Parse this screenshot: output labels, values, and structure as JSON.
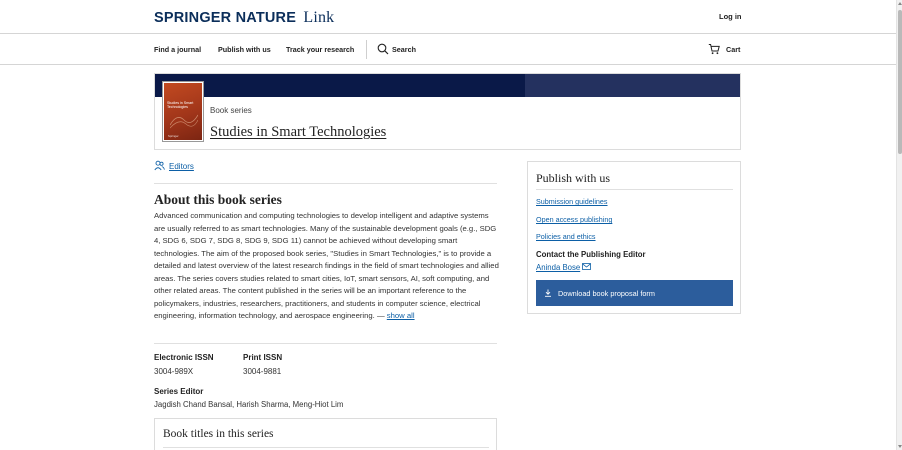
{
  "header": {
    "logo_brand": "SPRINGER NATURE",
    "logo_link": "Link",
    "login_label": "Log in"
  },
  "nav": {
    "find_journal": "Find a journal",
    "publish_with_us": "Publish with us",
    "track_research": "Track your research",
    "search_label": "Search",
    "cart_label": "Cart"
  },
  "hero": {
    "cover_title": "Studies in Smart Technologies",
    "cover_publisher": "Springer",
    "kicker": "Book series",
    "title": "Studies in Smart Technologies"
  },
  "editors_link": "Editors",
  "about": {
    "heading": "About this book series",
    "text": "Advanced communication and computing technologies to develop intelligent and adaptive systems are usually referred to as smart technologies. Many of the sustainable development goals (e.g., SDG 4, SDG 6, SDG 7, SDG 8, SDG 9, SDG 11) cannot be achieved without developing smart technologies. The aim of the proposed book series, \"Studies in Smart Technologies,\" is to provide a detailed and latest overview of the latest research findings in the field of smart technologies and allied areas. The series covers studies related to smart cities, IoT, smart sensors, AI, soft computing, and other related areas. The content published in the series will be an important reference to the policymakers, industries, researchers, practitioners, and students in computer science, electrical engineering, information technology, and aerospace engineering. — ",
    "show_all": "show all"
  },
  "issn": {
    "electronic_label": "Electronic ISSN",
    "electronic_value": "3004-989X",
    "print_label": "Print ISSN",
    "print_value": "3004-9881"
  },
  "series_editor": {
    "label": "Series Editor",
    "value": "Jagdish Chand Bansal, Harish Sharma, Meng-Hiot Lim"
  },
  "book_titles_heading": "Book titles in this series",
  "publish_card": {
    "heading": "Publish with us",
    "links": [
      "Submission guidelines",
      "Open access publishing",
      "Policies and ethics"
    ],
    "contact_label": "Contact the Publishing Editor",
    "editor_name": "Aninda Bose",
    "download_label": "Download book proposal form"
  },
  "colors": {
    "brand_navy": "#0a1948",
    "link_blue": "#0c5fa6",
    "button_blue": "#2c5d9c",
    "cover_orange": "#c24a21"
  },
  "icons": [
    "search-icon",
    "cart-icon",
    "editors-icon",
    "mail-icon",
    "download-icon"
  ]
}
